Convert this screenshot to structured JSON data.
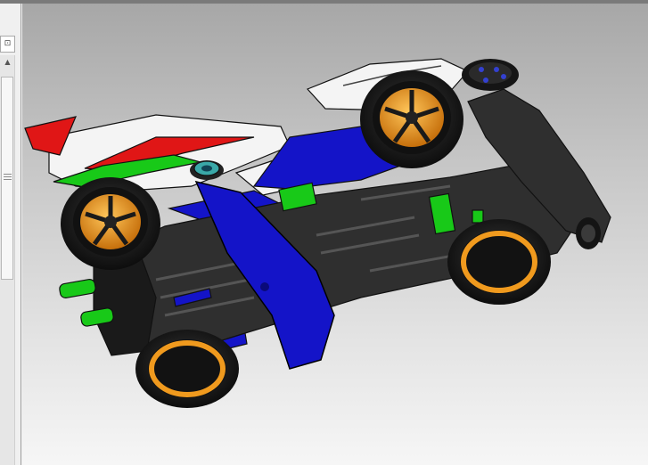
{
  "window": {
    "panel_tab_label": "⊡",
    "scroll_up_glyph": "▲"
  },
  "icons": {
    "panel_tab": "panel-restore-icon",
    "scroll_up": "chevron-up-icon",
    "scroll_grip": "grip-icon"
  },
  "model": {
    "colors": {
      "chassis": "#2f2f2f",
      "chassis_dark": "#1a1a1a",
      "blue_part": "#1414c8",
      "body_white": "#f4f4f4",
      "accent_red": "#e01616",
      "accent_green": "#18c918",
      "wheel_orange": "#f09a1e",
      "roller_teal": "#3aa8a8"
    }
  }
}
